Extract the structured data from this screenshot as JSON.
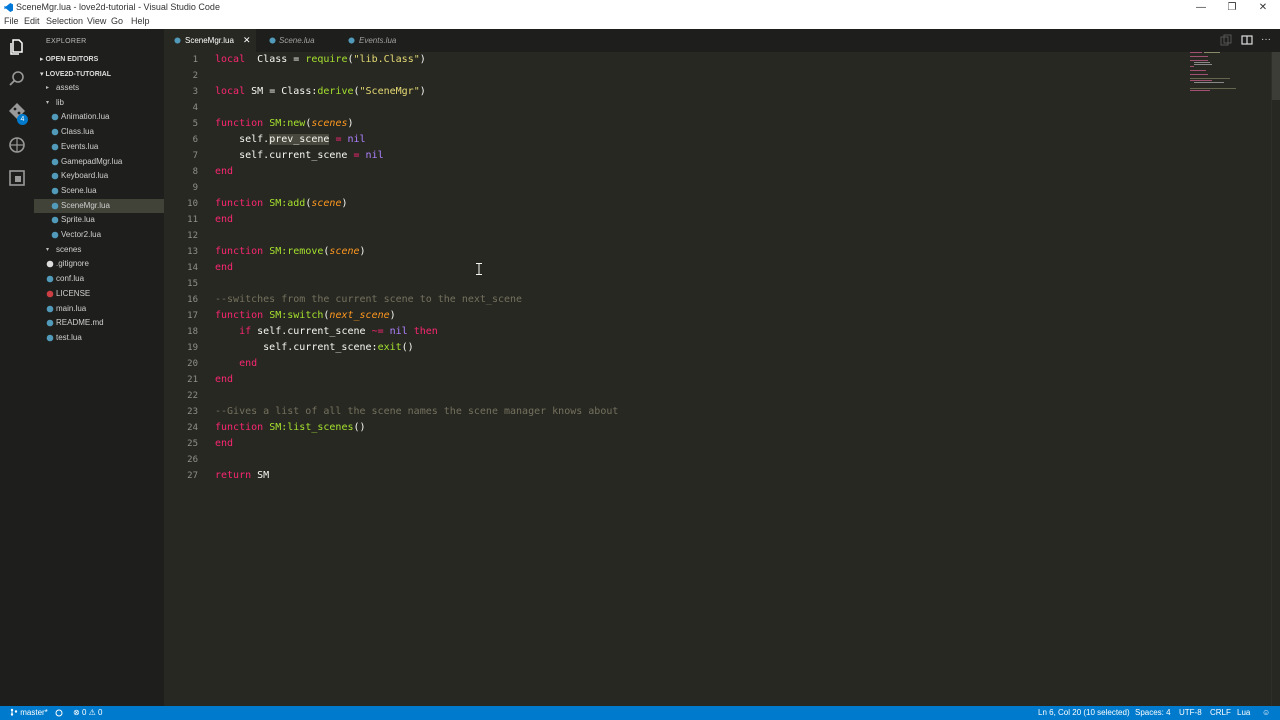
{
  "window": {
    "title": "SceneMgr.lua - love2d-tutorial - Visual Studio Code",
    "minimize_glyph": "—",
    "restore_glyph": "❐",
    "close_glyph": "✕"
  },
  "menu": [
    "File",
    "Edit",
    "Selection",
    "View",
    "Go",
    "Help"
  ],
  "sidebar": {
    "title": "EXPLORER",
    "open_editors": "OPEN EDITORS",
    "project": "LOVE2D-TUTORIAL",
    "tree": [
      {
        "label": "assets",
        "type": "folder",
        "expanded": false,
        "depth": 1
      },
      {
        "label": "lib",
        "type": "folder",
        "expanded": true,
        "depth": 1
      },
      {
        "label": "Animation.lua",
        "type": "lua",
        "depth": 2
      },
      {
        "label": "Class.lua",
        "type": "lua",
        "depth": 2
      },
      {
        "label": "Events.lua",
        "type": "lua",
        "depth": 2
      },
      {
        "label": "GamepadMgr.lua",
        "type": "lua",
        "depth": 2
      },
      {
        "label": "Keyboard.lua",
        "type": "lua",
        "depth": 2
      },
      {
        "label": "Scene.lua",
        "type": "lua",
        "depth": 2
      },
      {
        "label": "SceneMgr.lua",
        "type": "lua",
        "depth": 2,
        "selected": true
      },
      {
        "label": "Sprite.lua",
        "type": "lua",
        "depth": 2
      },
      {
        "label": "Vector2.lua",
        "type": "lua",
        "depth": 2
      },
      {
        "label": "scenes",
        "type": "folder",
        "expanded": true,
        "depth": 1
      },
      {
        "label": ".gitignore",
        "type": "git",
        "depth": 1
      },
      {
        "label": "conf.lua",
        "type": "lua",
        "depth": 1
      },
      {
        "label": "LICENSE",
        "type": "license",
        "depth": 1
      },
      {
        "label": "main.lua",
        "type": "lua",
        "depth": 1
      },
      {
        "label": "README.md",
        "type": "md",
        "depth": 1
      },
      {
        "label": "test.lua",
        "type": "lua",
        "depth": 1
      }
    ]
  },
  "activity": {
    "scm_badge": "4"
  },
  "tabs": [
    {
      "label": "SceneMgr.lua",
      "active": true,
      "close": "✕"
    },
    {
      "label": "Scene.lua",
      "active": false
    },
    {
      "label": "Events.lua",
      "active": false
    }
  ],
  "editor": {
    "lines": [
      {
        "n": "1",
        "tokens": [
          [
            "kw",
            "local"
          ],
          [
            "",
            "  "
          ],
          [
            "",
            "Class = "
          ],
          [
            "fn",
            "require"
          ],
          [
            "",
            "("
          ],
          [
            "str",
            "\"lib.Class\""
          ],
          [
            "",
            ")"
          ]
        ]
      },
      {
        "n": "2",
        "tokens": []
      },
      {
        "n": "3",
        "tokens": [
          [
            "kw",
            "local"
          ],
          [
            "",
            " SM = Class:"
          ],
          [
            "fn",
            "derive"
          ],
          [
            "",
            "("
          ],
          [
            "str",
            "\"SceneMgr\""
          ],
          [
            "",
            ")"
          ]
        ]
      },
      {
        "n": "4",
        "tokens": []
      },
      {
        "n": "5",
        "tokens": [
          [
            "kw",
            "function"
          ],
          [
            "",
            " "
          ],
          [
            "fn",
            "SM:new"
          ],
          [
            "",
            "("
          ],
          [
            "prm",
            "scenes"
          ],
          [
            "",
            ")"
          ]
        ]
      },
      {
        "n": "6",
        "tokens": [
          [
            "",
            "    self."
          ],
          [
            "sel",
            "prev_scene"
          ],
          [
            "",
            " "
          ],
          [
            "kw",
            "="
          ],
          [
            "",
            " "
          ],
          [
            "cst",
            "nil"
          ]
        ]
      },
      {
        "n": "7",
        "tokens": [
          [
            "",
            "    self.current_scene "
          ],
          [
            "kw",
            "="
          ],
          [
            "",
            " "
          ],
          [
            "cst",
            "nil"
          ]
        ]
      },
      {
        "n": "8",
        "tokens": [
          [
            "kw",
            "end"
          ]
        ]
      },
      {
        "n": "9",
        "tokens": []
      },
      {
        "n": "10",
        "tokens": [
          [
            "kw",
            "function"
          ],
          [
            "",
            " "
          ],
          [
            "fn",
            "SM:add"
          ],
          [
            "",
            "("
          ],
          [
            "prm",
            "scene"
          ],
          [
            "",
            ")"
          ]
        ]
      },
      {
        "n": "11",
        "tokens": [
          [
            "kw",
            "end"
          ]
        ]
      },
      {
        "n": "12",
        "tokens": []
      },
      {
        "n": "13",
        "tokens": [
          [
            "kw",
            "function"
          ],
          [
            "",
            " "
          ],
          [
            "fn",
            "SM:remove"
          ],
          [
            "",
            "("
          ],
          [
            "prm",
            "scene"
          ],
          [
            "",
            ")"
          ]
        ]
      },
      {
        "n": "14",
        "tokens": [
          [
            "kw",
            "end"
          ]
        ]
      },
      {
        "n": "15",
        "tokens": []
      },
      {
        "n": "16",
        "tokens": [
          [
            "cmt",
            "--switches from the current scene to the next_scene"
          ]
        ]
      },
      {
        "n": "17",
        "tokens": [
          [
            "kw",
            "function"
          ],
          [
            "",
            " "
          ],
          [
            "fn",
            "SM:switch"
          ],
          [
            "",
            "("
          ],
          [
            "prm",
            "next_scene"
          ],
          [
            "",
            ")"
          ]
        ]
      },
      {
        "n": "18",
        "tokens": [
          [
            "",
            "    "
          ],
          [
            "kw",
            "if"
          ],
          [
            "",
            " self.current_scene "
          ],
          [
            "kw",
            "~="
          ],
          [
            "",
            " "
          ],
          [
            "cst",
            "nil"
          ],
          [
            "",
            " "
          ],
          [
            "kw",
            "then"
          ]
        ]
      },
      {
        "n": "19",
        "tokens": [
          [
            "",
            "        self.current_scene:"
          ],
          [
            "fn",
            "exit"
          ],
          [
            "",
            "()"
          ]
        ]
      },
      {
        "n": "20",
        "tokens": [
          [
            "",
            "    "
          ],
          [
            "kw",
            "end"
          ]
        ]
      },
      {
        "n": "21",
        "tokens": [
          [
            "kw",
            "end"
          ]
        ]
      },
      {
        "n": "22",
        "tokens": []
      },
      {
        "n": "23",
        "tokens": [
          [
            "cmt",
            "--Gives a list of all the scene names the scene manager knows about"
          ]
        ]
      },
      {
        "n": "24",
        "tokens": [
          [
            "kw",
            "function"
          ],
          [
            "",
            " "
          ],
          [
            "fn",
            "SM:list_scenes"
          ],
          [
            "",
            "()"
          ]
        ]
      },
      {
        "n": "25",
        "tokens": [
          [
            "kw",
            "end"
          ]
        ]
      },
      {
        "n": "26",
        "tokens": []
      },
      {
        "n": "27",
        "tokens": [
          [
            "kw",
            "return"
          ],
          [
            "",
            " SM"
          ]
        ]
      }
    ]
  },
  "status": {
    "branch": "master*",
    "errors": "0",
    "warnings": "0",
    "position": "Ln 6, Col 20 (10 selected)",
    "spaces": "Spaces: 4",
    "encoding": "UTF-8",
    "eol": "CRLF",
    "language": "Lua"
  },
  "colors": {
    "editor_bg": "#272822",
    "sidebar_bg": "#1e1f1c",
    "status_bg": "#007acc",
    "keyword": "#f92672",
    "function": "#a6e22e",
    "string": "#e6db74",
    "comment": "#75715e",
    "param": "#fd971f",
    "constant": "#ae81ff"
  }
}
